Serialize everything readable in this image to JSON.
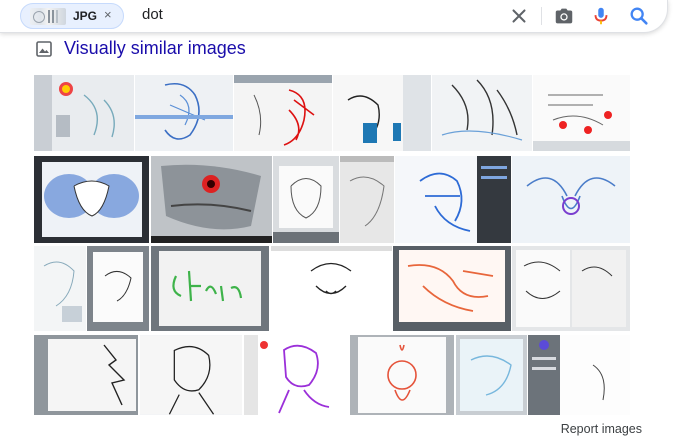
{
  "search": {
    "chip_label": "JPG",
    "chip_close_label": "×",
    "query": "dot",
    "clear_icon": "close-icon",
    "camera_icon": "camera-icon",
    "mic_icon": "microphone-icon",
    "search_icon": "magnifier-icon"
  },
  "section": {
    "icon": "image-icon",
    "title": "Visually similar images"
  },
  "footer": {
    "report_label": "Report images"
  },
  "colors": {
    "link": "#1a0dab",
    "google_blue": "#4285f4",
    "google_red": "#ea4335",
    "google_yellow": "#fbbc04",
    "google_green": "#34a853"
  }
}
